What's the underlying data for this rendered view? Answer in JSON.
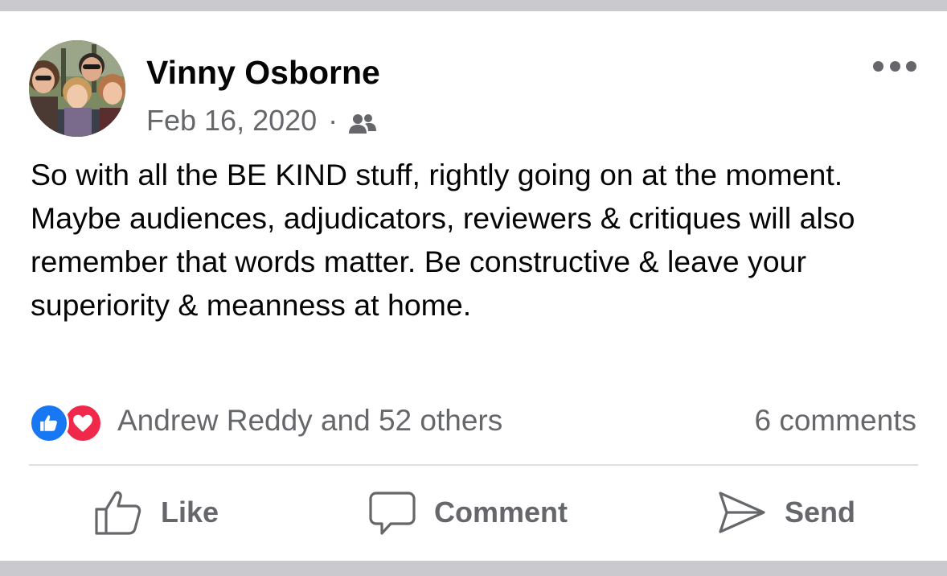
{
  "post": {
    "author": "Vinny Osborne",
    "date": "Feb 16, 2020",
    "separator": "·",
    "audience_icon": "friends-icon",
    "text": "So with all the BE KIND stuff, rightly going on at the moment. Maybe audiences, adjudicators, reviewers & critiques will also remember that words matter. Be constructive & leave your superiority & meanness at home."
  },
  "reactions": {
    "icons": [
      "like-reaction-icon",
      "love-reaction-icon"
    ],
    "summary": "Andrew Reddy and 52 others",
    "comments": "6 comments"
  },
  "actions": {
    "like": "Like",
    "comment": "Comment",
    "send": "Send"
  },
  "colors": {
    "like_blue": "#1877f2",
    "love_red": "#f0284a",
    "secondary_text": "#65676b",
    "primary_text": "#050505",
    "band_gray": "#c9c9ce"
  }
}
